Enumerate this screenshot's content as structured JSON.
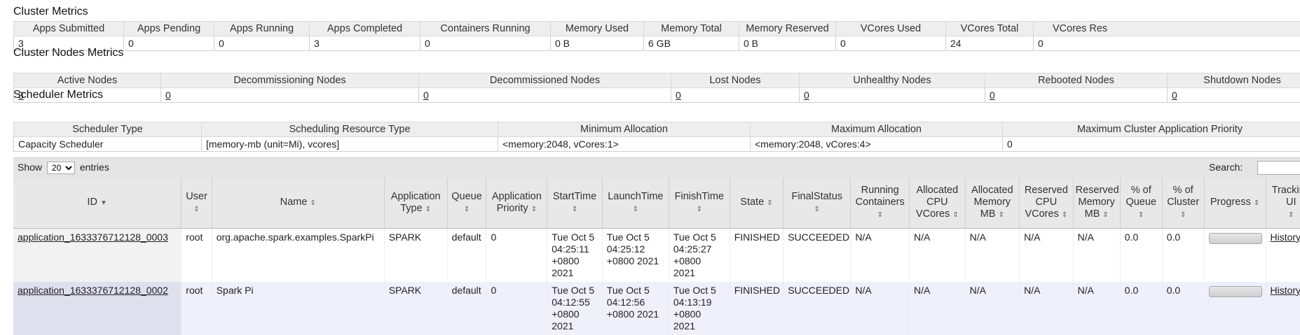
{
  "cluster_metrics": {
    "title": "Cluster Metrics",
    "headers": [
      "Apps Submitted",
      "Apps Pending",
      "Apps Running",
      "Apps Completed",
      "Containers Running",
      "Memory Used",
      "Memory Total",
      "Memory Reserved",
      "VCores Used",
      "VCores Total",
      "VCores Res"
    ],
    "values": [
      "3",
      "0",
      "0",
      "3",
      "0",
      "0 B",
      "6 GB",
      "0 B",
      "0",
      "24",
      "0"
    ]
  },
  "nodes_metrics": {
    "title": "Cluster Nodes Metrics",
    "headers": [
      "Active Nodes",
      "Decommissioning Nodes",
      "Decommissioned Nodes",
      "Lost Nodes",
      "Unhealthy Nodes",
      "Rebooted Nodes",
      "Shutdown Nodes"
    ],
    "values": [
      "3",
      "0",
      "0",
      "0",
      "0",
      "0",
      "0"
    ]
  },
  "scheduler_metrics": {
    "title": "Scheduler Metrics",
    "headers": [
      "Scheduler Type",
      "Scheduling Resource Type",
      "Minimum Allocation",
      "Maximum Allocation",
      "Maximum Cluster Application Priority"
    ],
    "values": [
      "Capacity Scheduler",
      "[memory-mb (unit=Mi), vcores]",
      "<memory:2048, vCores:1>",
      "<memory:2048, vCores:4>",
      "0"
    ]
  },
  "table_controls": {
    "show_label": "Show",
    "entries_value": "20",
    "entries_label": "entries",
    "search_label": "Search:"
  },
  "apps": {
    "headers": [
      "ID",
      "User",
      "Name",
      "Application Type",
      "Queue",
      "Application Priority",
      "StartTime",
      "LaunchTime",
      "FinishTime",
      "State",
      "FinalStatus",
      "Running Containers",
      "Allocated CPU VCores",
      "Allocated Memory MB",
      "Reserved CPU VCores",
      "Reserved Memory MB",
      "% of Queue",
      "% of Cluster",
      "Progress",
      "Tracking UI"
    ],
    "rows": [
      {
        "id": "application_1633376712128_0003",
        "user": "root",
        "name": "org.apache.spark.examples.SparkPi",
        "type": "SPARK",
        "queue": "default",
        "priority": "0",
        "start": "Tue Oct 5 04:25:11 +0800 2021",
        "launch": "Tue Oct 5 04:25:12 +0800 2021",
        "finish": "Tue Oct 5 04:25:27 +0800 2021",
        "state": "FINISHED",
        "final_status": "SUCCEEDED",
        "running_containers": "N/A",
        "alloc_vcores": "N/A",
        "alloc_mem": "N/A",
        "res_vcores": "N/A",
        "res_mem": "N/A",
        "pct_queue": "0.0",
        "pct_cluster": "0.0",
        "tracking": "History"
      },
      {
        "id": "application_1633376712128_0002",
        "user": "root",
        "name": "Spark Pi",
        "type": "SPARK",
        "queue": "default",
        "priority": "0",
        "start": "Tue Oct 5 04:12:55 +0800 2021",
        "launch": "Tue Oct 5 04:12:56 +0800 2021",
        "finish": "Tue Oct 5 04:13:19 +0800 2021",
        "state": "FINISHED",
        "final_status": "SUCCEEDED",
        "running_containers": "N/A",
        "alloc_vcores": "N/A",
        "alloc_mem": "N/A",
        "res_vcores": "N/A",
        "res_mem": "N/A",
        "pct_queue": "0.0",
        "pct_cluster": "0.0",
        "tracking": "History"
      }
    ]
  }
}
